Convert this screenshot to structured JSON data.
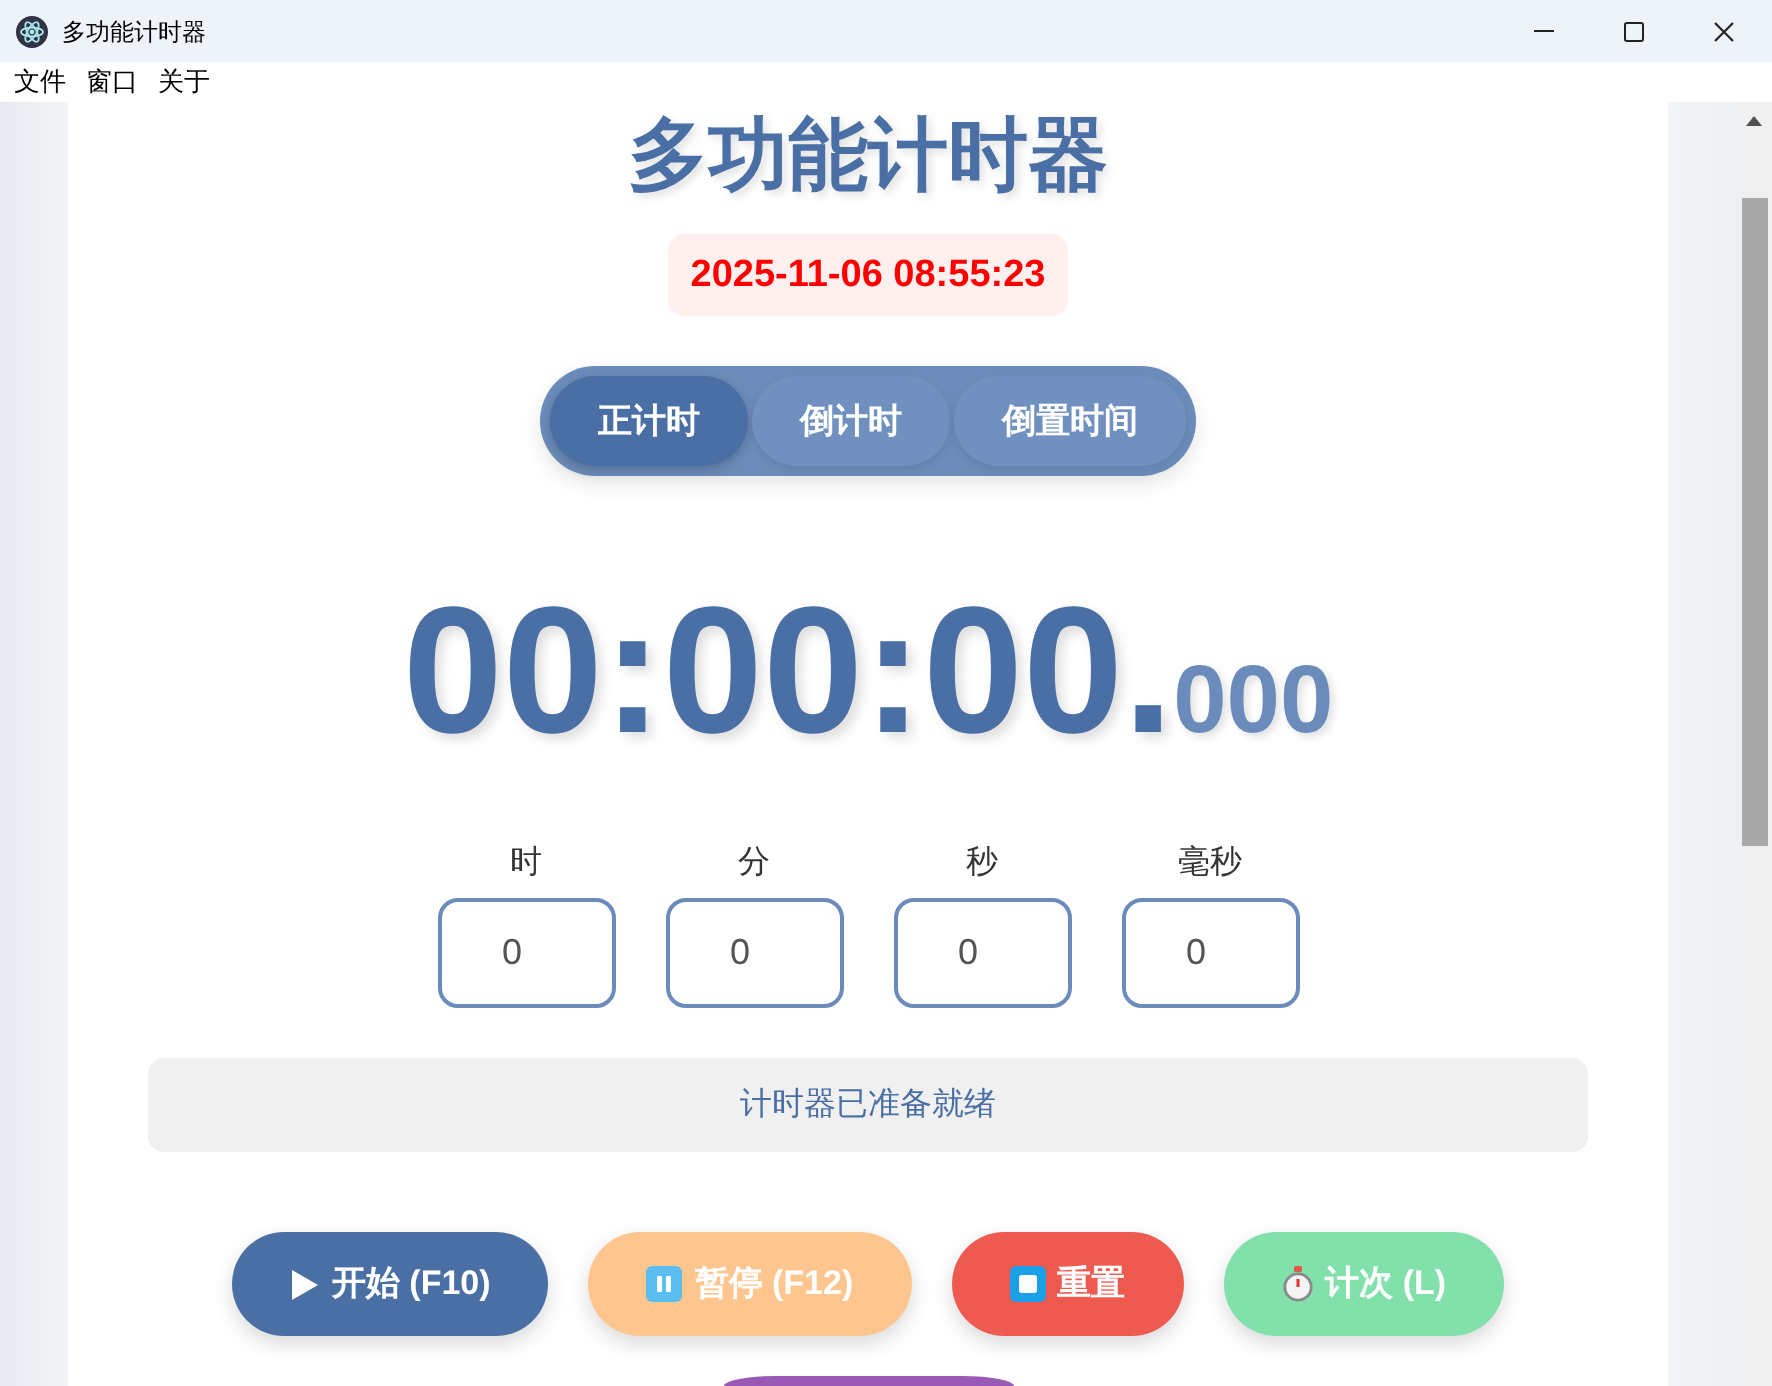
{
  "window": {
    "title": "多功能计时器"
  },
  "menu": [
    "文件",
    "窗口",
    "关于"
  ],
  "header": {
    "title": "多功能计时器",
    "datetime": "2025-11-06 08:55:23"
  },
  "mode_tabs": [
    {
      "label": "正计时",
      "selected": true
    },
    {
      "label": "倒计时",
      "selected": false
    },
    {
      "label": "倒置时间",
      "selected": false
    }
  ],
  "display": {
    "time": "00:00:00.",
    "milliseconds": "000"
  },
  "time_inputs": [
    {
      "label": "时",
      "value": "0"
    },
    {
      "label": "分",
      "value": "0"
    },
    {
      "label": "秒",
      "value": "0"
    },
    {
      "label": "毫秒",
      "value": "0"
    }
  ],
  "status": "计时器已准备就绪",
  "buttons": [
    {
      "kind": "start",
      "label": "开始 (F10)",
      "color": "#4a6fa5"
    },
    {
      "kind": "pause",
      "label": "暂停 (F12)",
      "color": "#ffc58f"
    },
    {
      "kind": "reset",
      "label": "重置",
      "color": "#ef5a50"
    },
    {
      "kind": "lap",
      "label": "计次 (L)",
      "color": "#82e0aa"
    }
  ],
  "cut_off_button": {
    "color": "#9b59b6"
  }
}
